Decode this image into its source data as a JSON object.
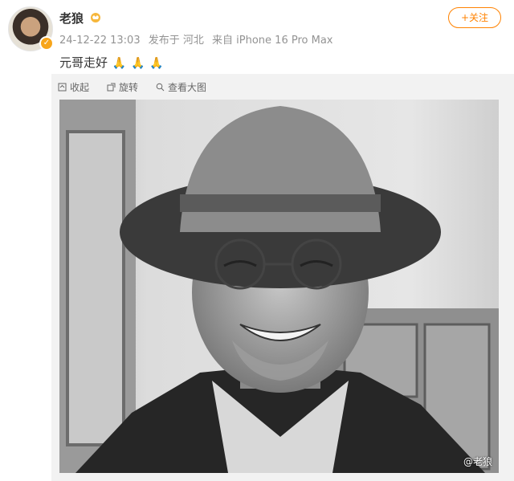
{
  "post": {
    "username": "老狼",
    "meta_date": "24-12-22 13:03",
    "meta_location": "发布于 河北",
    "meta_device": "来自 iPhone 16 Pro Max",
    "follow_label": "+关注",
    "text": "元哥走好",
    "emoji": [
      "🙏",
      "🙏",
      "🙏"
    ]
  },
  "toolbar": {
    "collect_label": "收起",
    "rotate_label": "旋转",
    "view_large_label": "查看大图"
  },
  "image": {
    "watermark": "@老狼"
  },
  "colors": {
    "accent": "#ff8200",
    "meta": "#939393",
    "text": "#333333",
    "panel": "#f2f2f2"
  }
}
